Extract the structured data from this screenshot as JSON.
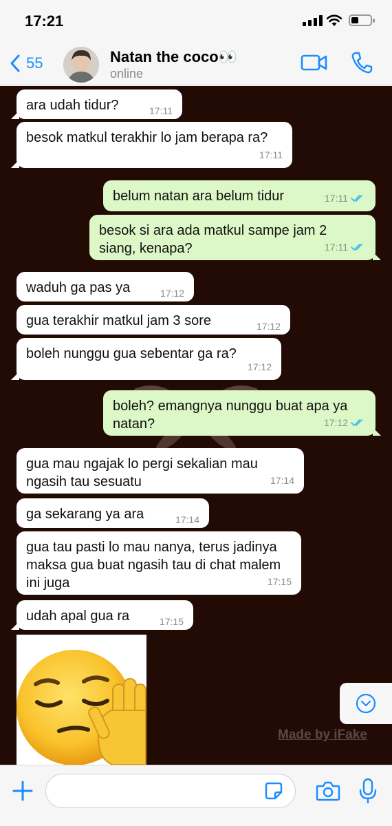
{
  "status": {
    "time": "17:21"
  },
  "header": {
    "back_count": "55",
    "contact_name": "Natan the coco👀",
    "contact_status": "online"
  },
  "messages": [
    {
      "dir": "in",
      "text": "ara udah tidur?",
      "time": "17:11"
    },
    {
      "dir": "in",
      "text": "besok matkul terakhir lo jam berapa ra?",
      "time": "17:11"
    },
    {
      "dir": "out",
      "text": "belum natan ara belum tidur",
      "time": "17:11",
      "read": true
    },
    {
      "dir": "out",
      "text": "besok si ara ada matkul sampe jam 2 siang, kenapa?",
      "time": "17:11",
      "read": true
    },
    {
      "dir": "in",
      "text": "waduh ga pas ya",
      "time": "17:12"
    },
    {
      "dir": "in",
      "text": "gua terakhir matkul jam 3 sore",
      "time": "17:12"
    },
    {
      "dir": "in",
      "text": "boleh nunggu gua sebentar ga ra?",
      "time": "17:12"
    },
    {
      "dir": "out",
      "text": "boleh? emangnya nunggu buat apa ya natan?",
      "time": "17:12",
      "read": true
    },
    {
      "dir": "in",
      "text": "gua mau ngajak lo pergi sekalian mau ngasih tau sesuatu",
      "time": "17:14"
    },
    {
      "dir": "in",
      "text": "ga sekarang ya ara",
      "time": "17:14"
    },
    {
      "dir": "in",
      "text": "gua tau pasti lo mau nanya, terus jadinya maksa gua buat ngasih tau di chat malem ini juga",
      "time": "17:15"
    },
    {
      "dir": "in",
      "text": "udah apal gua ra",
      "time": "17:15"
    }
  ],
  "sticker": {
    "icon": "pensive-face-raised-hand-sticker"
  },
  "watermark": "Made by iFake",
  "colors": {
    "accent": "#1a8cff",
    "outgoing_bubble": "#dbf8c6",
    "incoming_bubble": "#ffffff",
    "chat_background": "#220a05",
    "read_ticks": "#34b7f1"
  }
}
